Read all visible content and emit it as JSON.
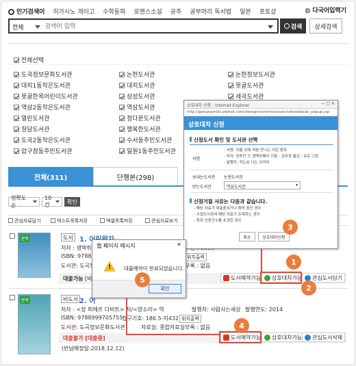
{
  "nav": {
    "popular": "인기검색어",
    "items": [
      "히가시노 게이고",
      "수학동화",
      "로맨스소설",
      "공주",
      "공부머리 독서법",
      "일본",
      "포토샵"
    ],
    "lang": "다국어입력기"
  },
  "search": {
    "scope": "전체",
    "placeholder": "검색어 입력",
    "button": "검색",
    "advanced": "상세검색"
  },
  "libraries": {
    "select_all": "전체선택",
    "col1": [
      "도곡정보문화도서관",
      "대치1동작은도서관",
      "못골한옥어린이도서관",
      "역삼2동작은도서관",
      "열린도서관",
      "청담도서관",
      "도곡2동작은도서관",
      "압구정동주민도서관"
    ],
    "col2": [
      "논현도서관",
      "대치도서관",
      "삼성도서관",
      "역삼도서관",
      "정다운도서관",
      "행복한도서관",
      "수서동주민도서관",
      "일원1동주민도서관"
    ],
    "col3": [
      "논현정보도서관",
      "못골도서관",
      "세곡도서관"
    ]
  },
  "tabs": [
    "전체(311)",
    "단행본(298)"
  ],
  "controls": {
    "sort": "정확도순",
    "count": "10건",
    "confirm": "확인"
  },
  "toolbar": [
    "관심자료담기",
    "텍스트목록저장",
    "엑셀목록저장",
    "관심자료보기"
  ],
  "book1": {
    "cover_badge": "문학",
    "type": "도서",
    "title": "1. 어린왕자",
    "author": "저자 : 생텍쥐페",
    "isbn": "ISBN: 978895",
    "library": "도서관: 도곡정",
    "location_btn": "위치출력",
    "right1": "간 / 2018",
    "right2": "위치출력",
    "right3": "부록 : 없음",
    "status": "대출가능",
    "status_note": "[비치",
    "btn_reserve": "도서예약가능",
    "btn_interlib": "상호대차가능",
    "btn_fav": "관심도서담기"
  },
  "book2": {
    "cover_badge": "문학",
    "type": "비도서",
    "title": "2. 어",
    "author": "저자 : <장 피에르 다비트> 저/<양소라> 역",
    "publisher": "발행처: 사람사는세상",
    "year": "발행연도: 2014",
    "isbn": "ISBN: 9788999705755",
    "callno": "청구기호: 186.5-지432",
    "location_btn": "위치출력",
    "library": "도서관: 도곡정보문화도서관",
    "room": "자료실: 종합자료실",
    "appendix": "부록 : 없음",
    "status": "대출불가 [대출중]",
    "return": "(반납예정일:2018.12.12)",
    "btn_reserve": "도서예약가능",
    "btn_interlib": "상호대차가능",
    "btn_delete": "관심도서삭제"
  },
  "popup": {
    "window_title": "상호대차 신청 - Internet Explorer",
    "url": "http://gangnamlib.yejinet.com/design/common/search/bookbada_popup.jsp",
    "header": "상호대차 신청",
    "section1": "신청도서 확인 및 도서관 선택",
    "book_label": "서명",
    "book_lines": [
      "- 서명: 아름 상에 처음 만나는 어린 왕자",
      "- 저자: 앙투안 드 생텍쥐페리 지음 ; 김미경 옮김 ; 유유 그림",
      "- 발행자: 저는요 나는 코끼리"
    ],
    "send_label": "보내는도서관",
    "send_value": "논현도서관",
    "recv_label": "받는도서관",
    "recv_value": "역삼도서관",
    "section2": "신청거절 사유는 다음과 같습니다.",
    "reasons": [
      "- 해당 자료가 대출중이거나 예약 중인 경우",
      "- 수업도서관에 해당 자료가 존재하는 경우",
      "- 최대 신청건수를 초과한 경우"
    ],
    "cancel": "취소",
    "submit": "상호대차신청"
  },
  "dialog": {
    "title": "웹 페이지 메시지",
    "message": "대출예약이 완료되었습니다.",
    "ok": "확인"
  },
  "steps": [
    "1",
    "2",
    "3",
    "4",
    "5"
  ],
  "colors": {
    "accent": "#3a91d6",
    "step": "#ea7d3a",
    "highlight": "#e64a3a",
    "link": "#2f6fb8"
  }
}
